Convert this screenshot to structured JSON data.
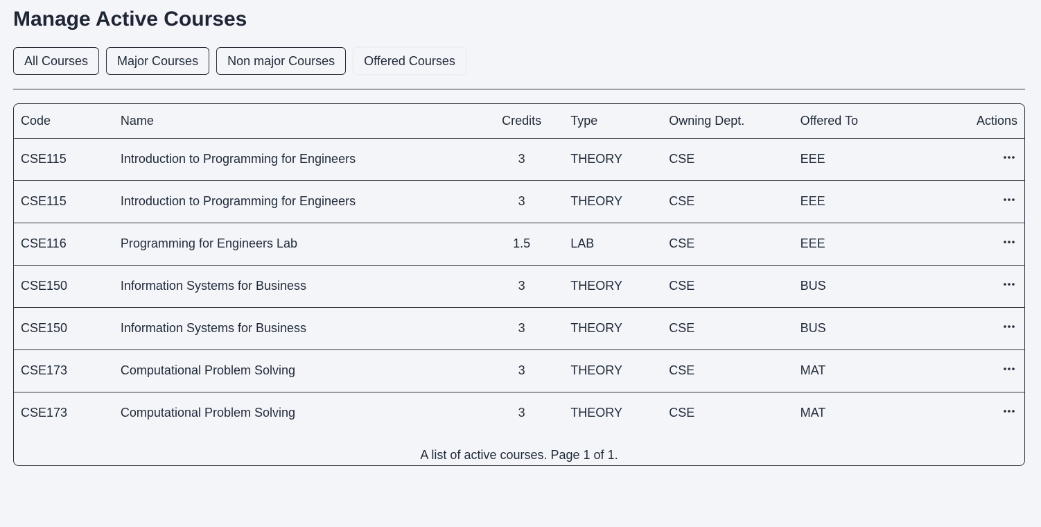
{
  "page": {
    "title": "Manage Active Courses"
  },
  "tabs": [
    {
      "label": "All Courses"
    },
    {
      "label": "Major Courses"
    },
    {
      "label": "Non major Courses"
    },
    {
      "label": "Offered Courses"
    }
  ],
  "table": {
    "headers": {
      "code": "Code",
      "name": "Name",
      "credits": "Credits",
      "type": "Type",
      "owning_dept": "Owning Dept.",
      "offered_to": "Offered To",
      "actions": "Actions"
    },
    "rows": [
      {
        "code": "CSE115",
        "name": "Introduction to Programming for Engineers",
        "credits": "3",
        "type": "THEORY",
        "owning_dept": "CSE",
        "offered_to": "EEE",
        "actions_icon": "more-horizontal-icon"
      },
      {
        "code": "CSE115",
        "name": "Introduction to Programming for Engineers",
        "credits": "3",
        "type": "THEORY",
        "owning_dept": "CSE",
        "offered_to": "EEE",
        "actions_icon": "more-horizontal-icon"
      },
      {
        "code": "CSE116",
        "name": "Programming for Engineers Lab",
        "credits": "1.5",
        "type": "LAB",
        "owning_dept": "CSE",
        "offered_to": "EEE",
        "actions_icon": "more-horizontal-icon"
      },
      {
        "code": "CSE150",
        "name": "Information Systems for Business",
        "credits": "3",
        "type": "THEORY",
        "owning_dept": "CSE",
        "offered_to": "BUS",
        "actions_icon": "more-horizontal-icon"
      },
      {
        "code": "CSE150",
        "name": "Information Systems for Business",
        "credits": "3",
        "type": "THEORY",
        "owning_dept": "CSE",
        "offered_to": "BUS",
        "actions_icon": "more-horizontal-icon"
      },
      {
        "code": "CSE173",
        "name": "Computational Problem Solving",
        "credits": "3",
        "type": "THEORY",
        "owning_dept": "CSE",
        "offered_to": "MAT",
        "actions_icon": "more-horizontal-icon"
      },
      {
        "code": "CSE173",
        "name": "Computational Problem Solving",
        "credits": "3",
        "type": "THEORY",
        "owning_dept": "CSE",
        "offered_to": "MAT",
        "actions_icon": "more-horizontal-icon"
      }
    ],
    "caption": "A list of active courses. Page 1 of 1."
  },
  "colors": {
    "background": "#f4f5f9",
    "text": "#1f2937",
    "border": "#2f333b"
  }
}
